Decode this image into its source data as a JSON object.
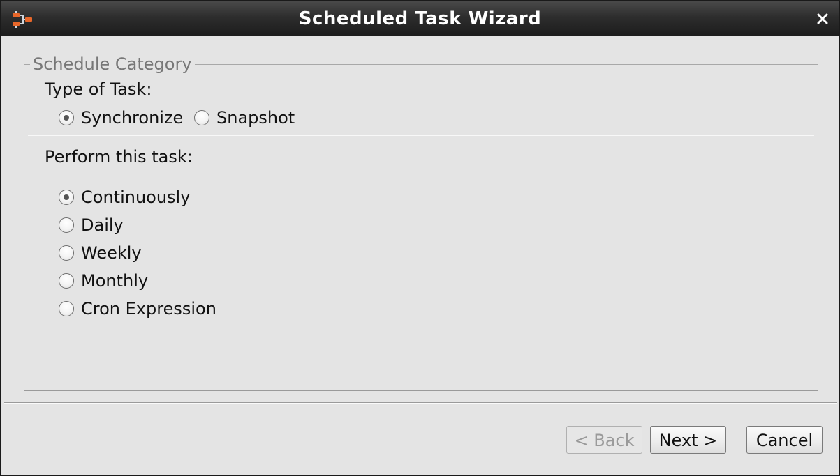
{
  "window": {
    "title": "Scheduled Task Wizard",
    "icon": "app-logo-icon",
    "close_icon": "close-icon"
  },
  "schedule_category": {
    "legend": "Schedule Category",
    "type_of_task": {
      "label": "Type of Task:",
      "options": [
        {
          "label": "Synchronize",
          "checked": true
        },
        {
          "label": "Snapshot",
          "checked": false
        }
      ]
    },
    "perform": {
      "label": "Perform this task:",
      "options": [
        {
          "label": "Continuously",
          "checked": true
        },
        {
          "label": "Daily",
          "checked": false
        },
        {
          "label": "Weekly",
          "checked": false
        },
        {
          "label": "Monthly",
          "checked": false
        },
        {
          "label": "Cron Expression",
          "checked": false
        }
      ]
    }
  },
  "buttons": {
    "back": {
      "label": "< Back",
      "enabled": false
    },
    "next": {
      "label": "Next >",
      "enabled": true
    },
    "cancel": {
      "label": "Cancel",
      "enabled": true
    }
  },
  "colors": {
    "titlebar": "#2d2d2d",
    "background": "#e4e4e4",
    "accent_icon": "#e8672a"
  }
}
